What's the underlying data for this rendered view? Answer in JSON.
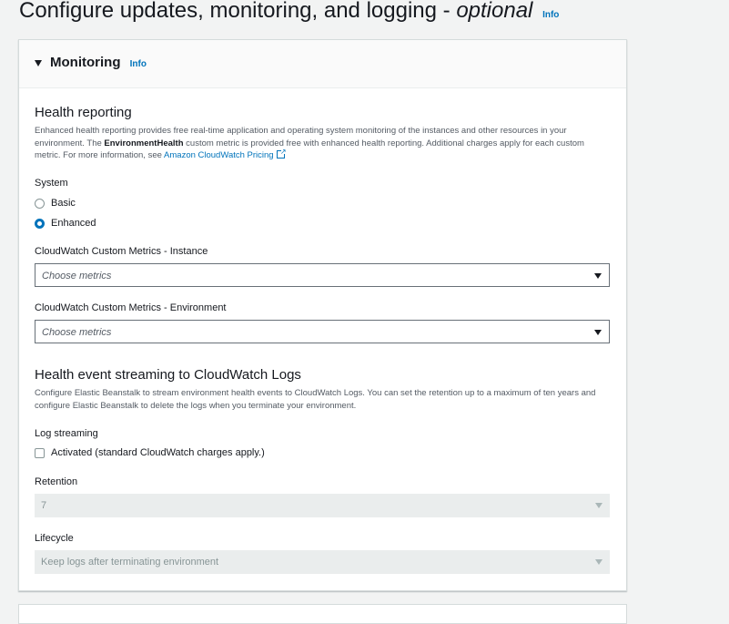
{
  "page": {
    "title_main": "Configure updates, monitoring, and logging - ",
    "title_optional": "optional",
    "info": "Info"
  },
  "monitoring": {
    "title": "Monitoring",
    "info": "Info",
    "health_reporting": {
      "heading": "Health reporting",
      "desc_part1": "Enhanced health reporting provides free real-time application and operating system monitoring of the instances and other resources in your environment. The ",
      "desc_bold": "EnvironmentHealth",
      "desc_part2": " custom metric is provided free with enhanced health reporting. Additional charges apply for each custom metric. For more information, see ",
      "desc_link": "Amazon CloudWatch Pricing",
      "system_label": "System",
      "options": [
        "Basic",
        "Enhanced"
      ],
      "selected": "Enhanced",
      "instance_metrics_label": "CloudWatch Custom Metrics - Instance",
      "instance_metrics_placeholder": "Choose metrics",
      "environment_metrics_label": "CloudWatch Custom Metrics - Environment",
      "environment_metrics_placeholder": "Choose metrics"
    },
    "health_streaming": {
      "heading": "Health event streaming to CloudWatch Logs",
      "desc": "Configure Elastic Beanstalk to stream environment health events to CloudWatch Logs. You can set the retention up to a maximum of ten years and configure Elastic Beanstalk to delete the logs when you terminate your environment.",
      "log_streaming_label": "Log streaming",
      "activated_label": "Activated (standard CloudWatch charges apply.)",
      "activated": false,
      "retention_label": "Retention",
      "retention_value": "7",
      "lifecycle_label": "Lifecycle",
      "lifecycle_value": "Keep logs after terminating environment"
    }
  }
}
